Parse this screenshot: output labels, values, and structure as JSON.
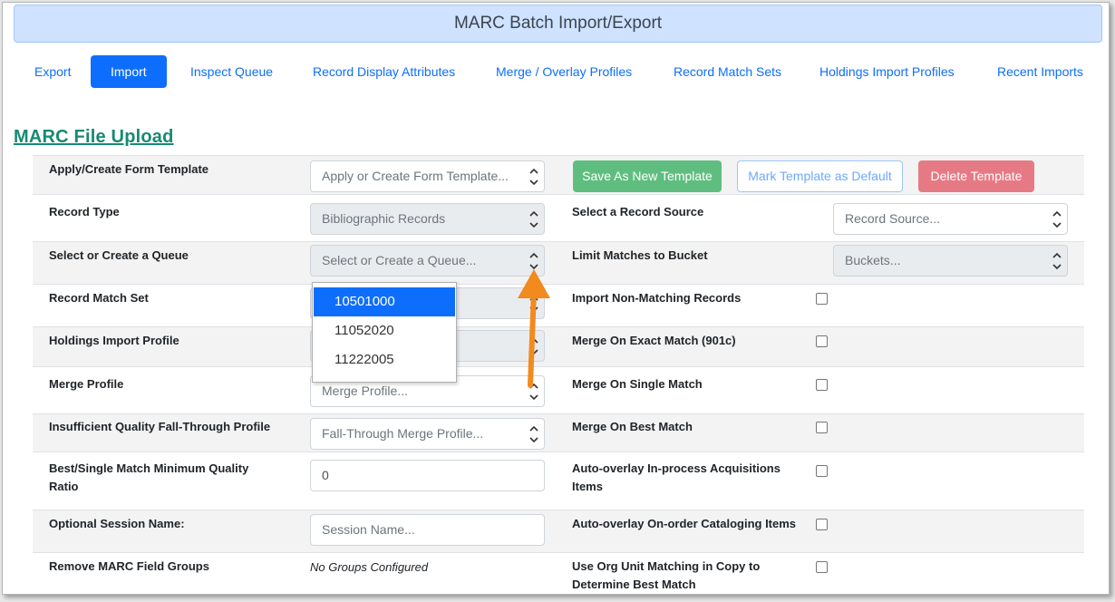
{
  "header": {
    "title": "MARC Batch Import/Export"
  },
  "tabs": [
    {
      "label": "Export"
    },
    {
      "label": "Import"
    },
    {
      "label": "Inspect Queue"
    },
    {
      "label": "Record Display Attributes"
    },
    {
      "label": "Merge / Overlay Profiles"
    },
    {
      "label": "Record Match Sets"
    },
    {
      "label": "Holdings Import Profiles"
    },
    {
      "label": "Recent Imports"
    }
  ],
  "active_tab": "Import",
  "section_title": "MARC File Upload",
  "template": {
    "label": "Apply/Create Form Template",
    "placeholder": "Apply or Create Form Template...",
    "save_label": "Save As New Template",
    "default_label": "Mark Template as Default",
    "delete_label": "Delete Template"
  },
  "fields": {
    "record_type": {
      "label": "Record Type",
      "value": "Bibliographic Records"
    },
    "record_source": {
      "label": "Select a Record Source",
      "placeholder": "Record Source..."
    },
    "queue": {
      "label": "Select or Create a Queue",
      "placeholder": "Select or Create a Queue..."
    },
    "bucket": {
      "label": "Limit Matches to Bucket",
      "placeholder": "Buckets..."
    },
    "match_set": {
      "label": "Record Match Set"
    },
    "non_matching": {
      "label": "Import Non-Matching Records"
    },
    "holdings_profile": {
      "label": "Holdings Import Profile"
    },
    "exact_match": {
      "label": "Merge On Exact Match (901c)"
    },
    "merge_profile": {
      "label": "Merge Profile",
      "placeholder": "Merge Profile..."
    },
    "single_match": {
      "label": "Merge On Single Match"
    },
    "fallthrough": {
      "label": "Insufficient Quality Fall-Through Profile",
      "placeholder": "Fall-Through Merge Profile..."
    },
    "best_match": {
      "label": "Merge On Best Match"
    },
    "min_quality": {
      "label_line1": "Best/Single Match Minimum Quality",
      "label_line2": "Ratio",
      "value": "0"
    },
    "acq_items": {
      "label_line1": "Auto-overlay In-process Acquisitions",
      "label_line2": "Items"
    },
    "session_name": {
      "label": "Optional Session Name:",
      "placeholder": "Session Name..."
    },
    "order_items": {
      "label": "Auto-overlay On-order Cataloging Items"
    },
    "field_groups": {
      "label": "Remove MARC Field Groups",
      "value": "No Groups Configured"
    },
    "org_unit": {
      "label_line1": "Use Org Unit Matching in Copy to",
      "label_line2": "Determine Best Match"
    }
  },
  "queue_options": [
    "10501000",
    "11052020",
    "11222005"
  ],
  "colors": {
    "primary": "#0d6efd",
    "success": "#5fbe7f",
    "danger": "#e67a84",
    "title": "#168a72",
    "annotation": "#f28a1e"
  }
}
